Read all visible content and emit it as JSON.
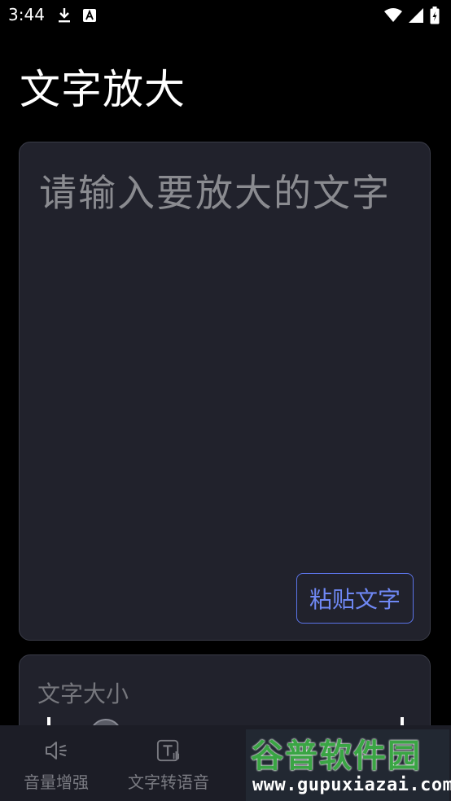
{
  "status_bar": {
    "time": "3:44",
    "icons_left": [
      "download-icon",
      "a-letter-icon"
    ],
    "icons_right": [
      "wifi-icon",
      "signal-icon",
      "battery-icon"
    ]
  },
  "page": {
    "title": "文字放大"
  },
  "input_card": {
    "placeholder": "请输入要放大的文字",
    "paste_label": "粘贴文字"
  },
  "size_card": {
    "label": "文字大小"
  },
  "bottom_nav": {
    "items": [
      {
        "label": "音量增强",
        "icon": "speaker-icon"
      },
      {
        "label": "文字转语音",
        "icon": "text-to-speech-icon"
      },
      {
        "label": "",
        "icon": ""
      },
      {
        "label": "",
        "icon": ""
      }
    ]
  },
  "watermark": {
    "main": "谷普软件园",
    "sub": "www.gupuxiazai.com"
  },
  "colors": {
    "background": "#000000",
    "card": "#21222c",
    "accent": "#6f88f4",
    "watermark_green": "#3aa544"
  }
}
